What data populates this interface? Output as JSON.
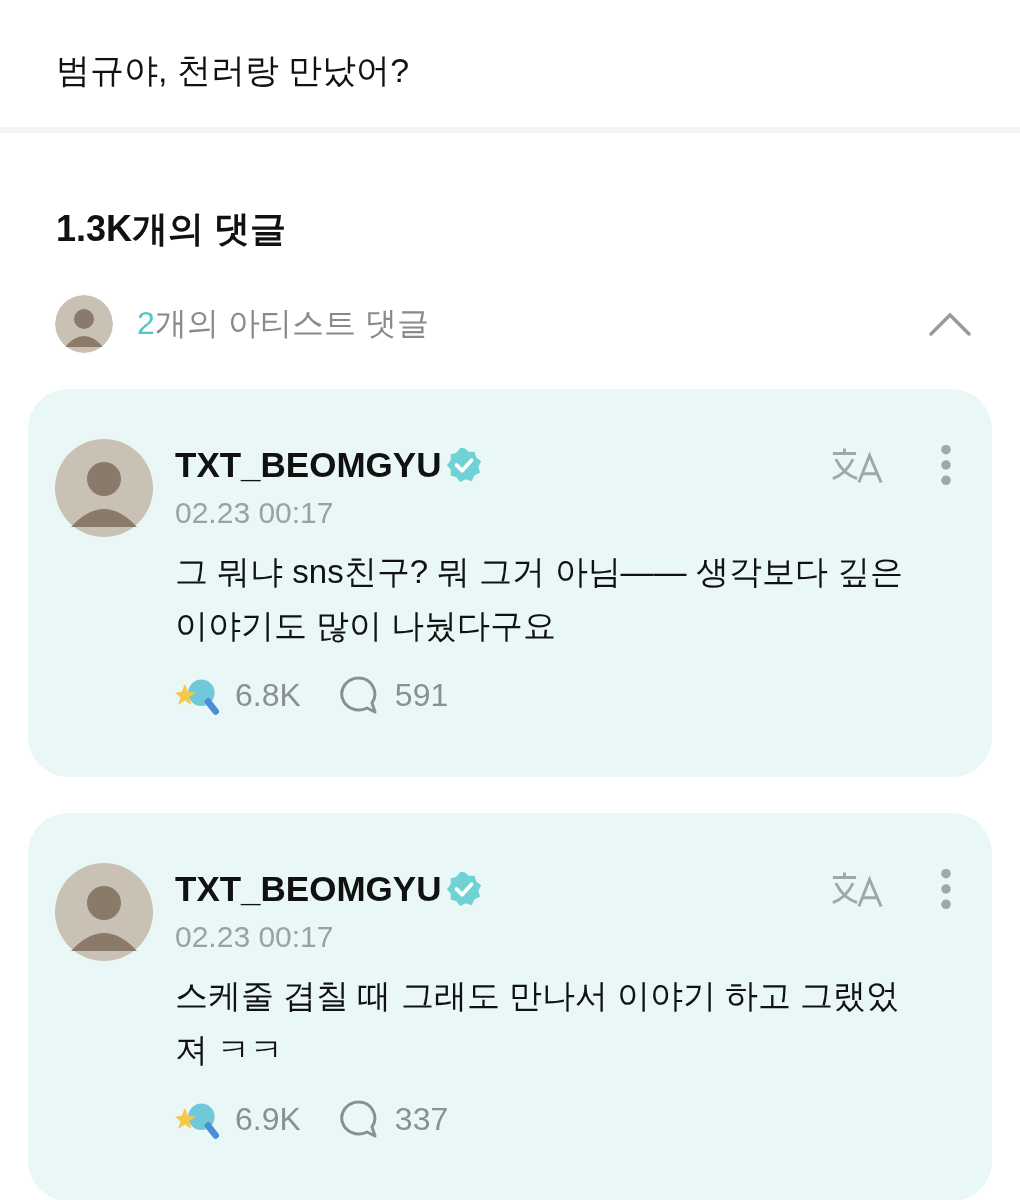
{
  "post": {
    "text": "범규야, 천러랑 만났어?"
  },
  "comments_header": {
    "title": "1.3K개의 댓글"
  },
  "artist_comments": {
    "count": "2",
    "label": "개의 아티스트 댓글",
    "expanded": true
  },
  "comments": [
    {
      "author": "TXT_BEOMGYU",
      "verified": true,
      "time": "02.23 00:17",
      "text": "그 뭐냐 sns친구? 뭐 그거 아님—— 생각보다 깊은 이야기도 많이 나눴다구요",
      "likes": "6.8K",
      "replies": "591"
    },
    {
      "author": "TXT_BEOMGYU",
      "verified": true,
      "time": "02.23 00:17",
      "text": "스케줄 겹칠 때 그래도 만나서 이야기 하고 그랬었져 ㅋㅋ",
      "likes": "6.9K",
      "replies": "337"
    }
  ]
}
